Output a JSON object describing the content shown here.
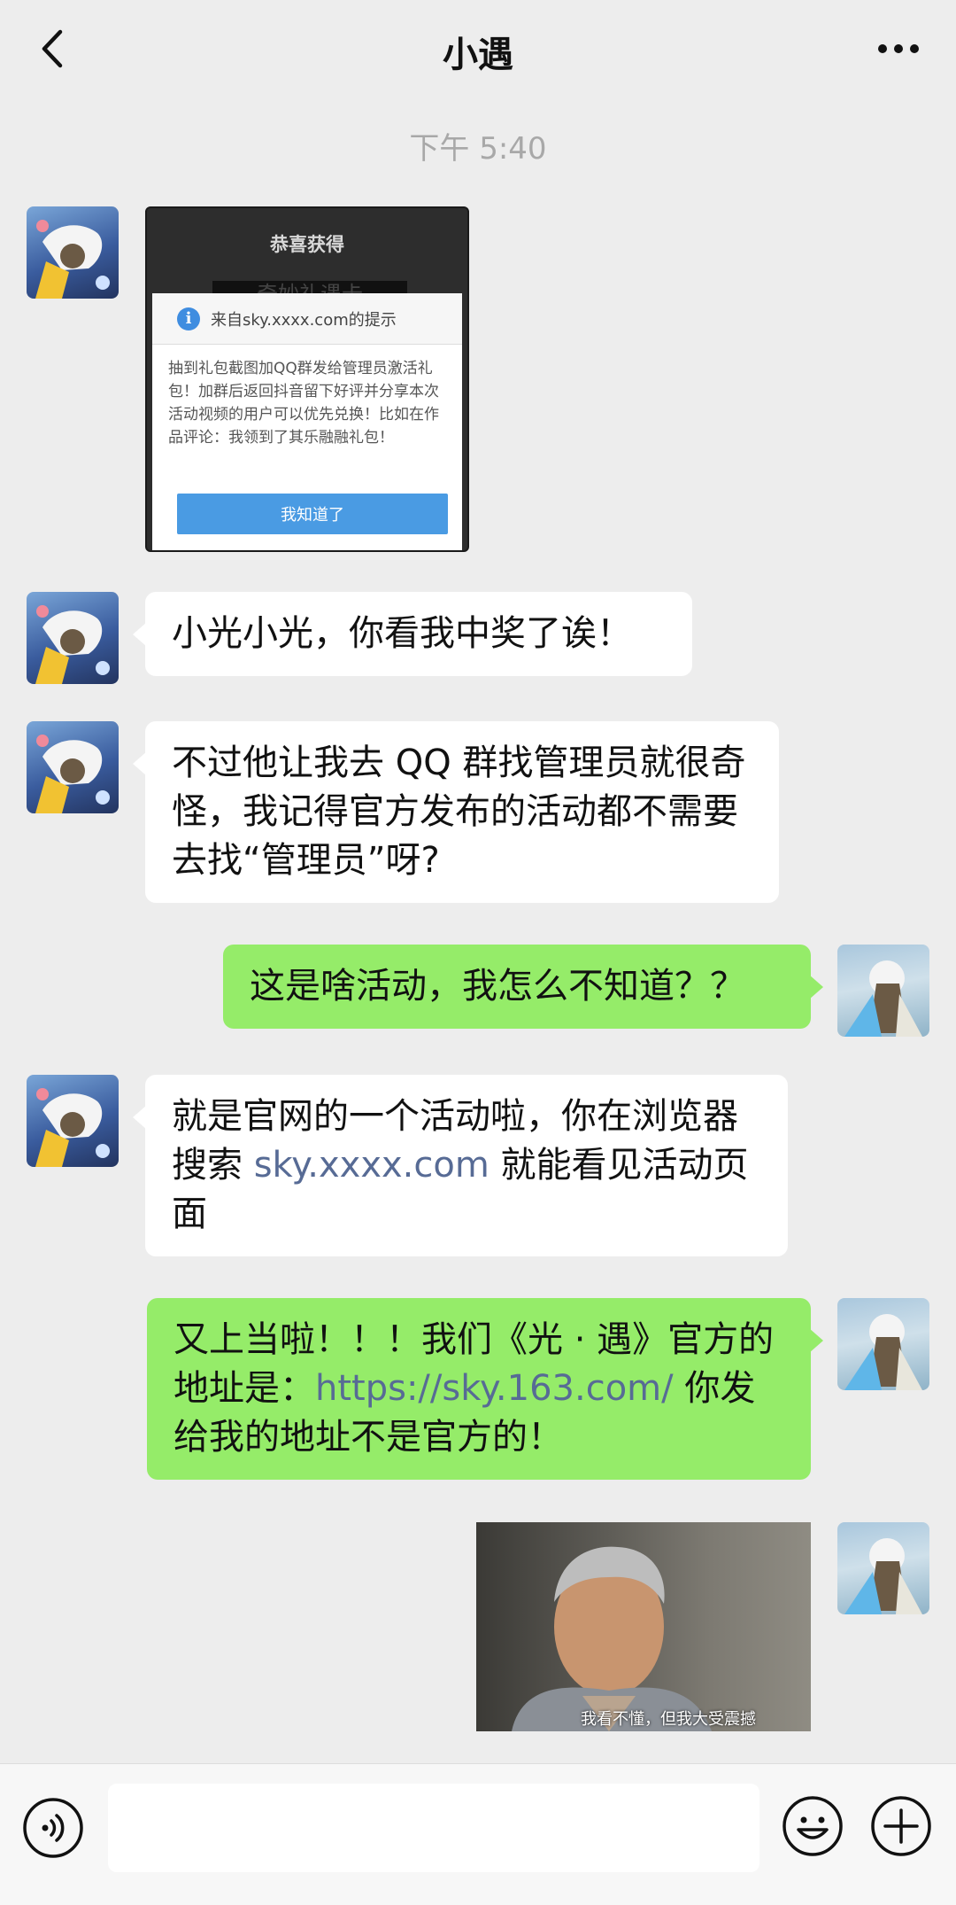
{
  "header": {
    "title": "小遇"
  },
  "timestamp": "下午 5:40",
  "screenshot": {
    "header": "恭喜获得",
    "banner": "奇妙礼遇卡",
    "dialog_title": "来自sky.xxxx.com的提示",
    "dialog_body": "抽到礼包截图加QQ群发给管理员激活礼包！加群后返回抖音留下好评并分享本次活动视频的用户可以优先兑换！比如在作品评论：我领到了其乐融融礼包！",
    "button": "我知道了"
  },
  "messages": [
    {
      "text": "小光小光，你看我中奖了诶！"
    },
    {
      "text": "不过他让我去 QQ 群找管理员就很奇怪，我记得官方发布的活动都不需要去找“管理员”呀?"
    },
    {
      "text": "这是啥活动，我怎么不知道？？"
    },
    {
      "before": "就是官网的一个活动啦，你在浏览器搜索 ",
      "link": "sky.xxxx.com",
      "after": " 就能看见活动页面"
    },
    {
      "before": "又上当啦！！！我们《光 · 遇》官方的地址是：",
      "link": "https://sky.163.com/",
      "after": " 你发给我的地址不是官方的！"
    }
  ],
  "meme": {
    "caption": "我看不懂，但我大受震撼"
  },
  "colors": {
    "background": "#ededed",
    "incoming": "#ffffff",
    "outgoing": "#95ec69",
    "link": "#576b95"
  },
  "icons": {
    "back": "chevron-left-icon",
    "more": "more-dots-icon",
    "voice": "voice-icon",
    "emoji": "emoji-icon",
    "plus": "plus-icon"
  }
}
